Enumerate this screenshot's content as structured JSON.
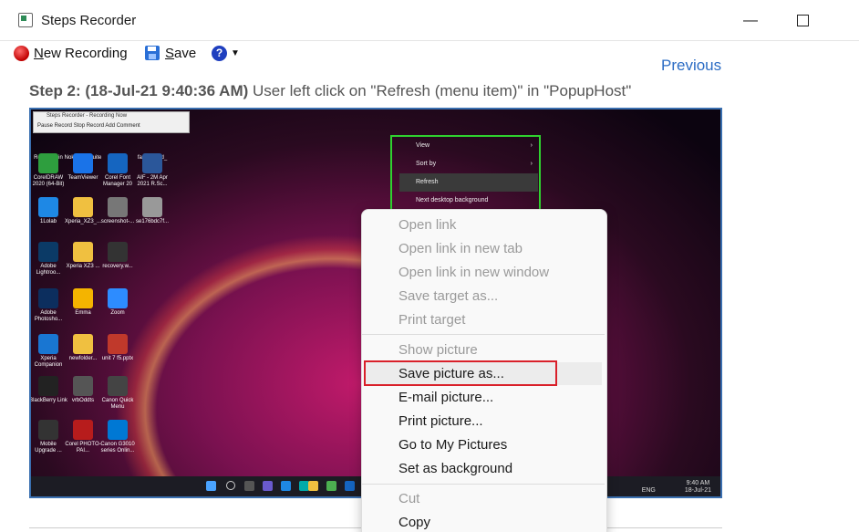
{
  "window": {
    "title": "Steps Recorder",
    "minimize_glyph": "—",
    "close_glyph": "✕"
  },
  "toolbar": {
    "new_recording_prefix": "N",
    "new_recording_rest": "ew Recording",
    "save_prefix": "S",
    "save_rest": "ave",
    "help_glyph": "?",
    "dropdown_glyph": "▼"
  },
  "nav": {
    "previous": "Previous"
  },
  "step": {
    "heading": "Step 2: (18-Jul-21 9:40:36 AM)",
    "description": " User left click on \"Refresh (menu item)\" in \"PopupHost\""
  },
  "screenshot": {
    "recorder_bar_title": "Steps Recorder - Recording Now",
    "recorder_bar_buttons": "Pause Record   Stop Record   Add Comment",
    "desktop_icons": [
      {
        "label": "Recycle Bin",
        "color": "#d9d9d9"
      },
      {
        "label": "Nokia PC Suite",
        "color": "#1f5fbf"
      },
      {
        "label": "Zuro",
        "color": "#666666"
      },
      {
        "label": "family_and_",
        "color": "#8a6a4a"
      },
      {
        "label": "CorelDRAW 2020 (64-Bit)",
        "color": "#2e9e3e"
      },
      {
        "label": "TeamViewer",
        "color": "#1a73e8"
      },
      {
        "label": "Corel Font Manager 20",
        "color": "#1565c0"
      },
      {
        "label": "AIF - 2M Apr 2021 R.Sc...",
        "color": "#2b579a"
      },
      {
        "label": "1Lolab",
        "color": "#1e88e5"
      },
      {
        "label": "Xperia_XZ3_...",
        "color": "#f0c040"
      },
      {
        "label": "screenshot-...",
        "color": "#777777"
      },
      {
        "label": "se176bdc7f...",
        "color": "#999999"
      },
      {
        "label": "Adobe Lightroo...",
        "color": "#0b3a66"
      },
      {
        "label": "Xperia XZ3 ...",
        "color": "#f0c040"
      },
      {
        "label": "recovery.w...",
        "color": "#333333"
      },
      {
        "label": "Adobe Photosho...",
        "color": "#0c2e5e"
      },
      {
        "label": "Emma",
        "color": "#f4b400"
      },
      {
        "label": "Zoom",
        "color": "#2d8cff"
      },
      {
        "label": "Xperia Companion",
        "color": "#1976d2"
      },
      {
        "label": "newfolder...",
        "color": "#f0c040"
      },
      {
        "label": "unit 7 f5.pptx",
        "color": "#c0392b"
      },
      {
        "label": "BlackBerry Link",
        "color": "#222222"
      },
      {
        "label": "vrbOddts",
        "color": "#555555"
      },
      {
        "label": "Canon Quick Menu",
        "color": "#444444"
      },
      {
        "label": "Mobile Upgrade ...",
        "color": "#333333"
      },
      {
        "label": "Corel PHOTO-PAI...",
        "color": "#b71c1c"
      },
      {
        "label": "Canon G3010 series Onlin...",
        "color": "#0078d4"
      }
    ],
    "inner_menu": [
      {
        "label": "View",
        "chevron": true,
        "highlight": false
      },
      {
        "label": "Sort by",
        "chevron": true,
        "highlight": false
      },
      {
        "label": "Refresh",
        "chevron": false,
        "highlight": true
      },
      {
        "label": "Next desktop background",
        "chevron": false,
        "highlight": false
      }
    ],
    "tray": {
      "lang": "ENG",
      "time": "9:40 AM",
      "date": "18-Jul-21"
    }
  },
  "context_menu": {
    "items": [
      {
        "label": "Open link",
        "disabled": true
      },
      {
        "label": "Open link in new tab",
        "disabled": true
      },
      {
        "label": "Open link in new window",
        "disabled": true
      },
      {
        "label": "Save target as...",
        "disabled": true
      },
      {
        "label": "Print target",
        "disabled": true
      },
      {
        "label": "Show picture",
        "disabled": true
      },
      {
        "label": "Save picture as...",
        "disabled": false
      },
      {
        "label": "E-mail picture...",
        "disabled": false
      },
      {
        "label": "Print picture...",
        "disabled": false
      },
      {
        "label": "Go to My Pictures",
        "disabled": false
      },
      {
        "label": "Set as background",
        "disabled": false
      },
      {
        "label": "Cut",
        "disabled": true
      },
      {
        "label": "Copy",
        "disabled": false
      }
    ]
  },
  "colors": {
    "link": "#2b6cc4",
    "highlight_box": "#d9202a",
    "green_box": "#2fd12f",
    "screenshot_border": "#3a6fb0"
  }
}
